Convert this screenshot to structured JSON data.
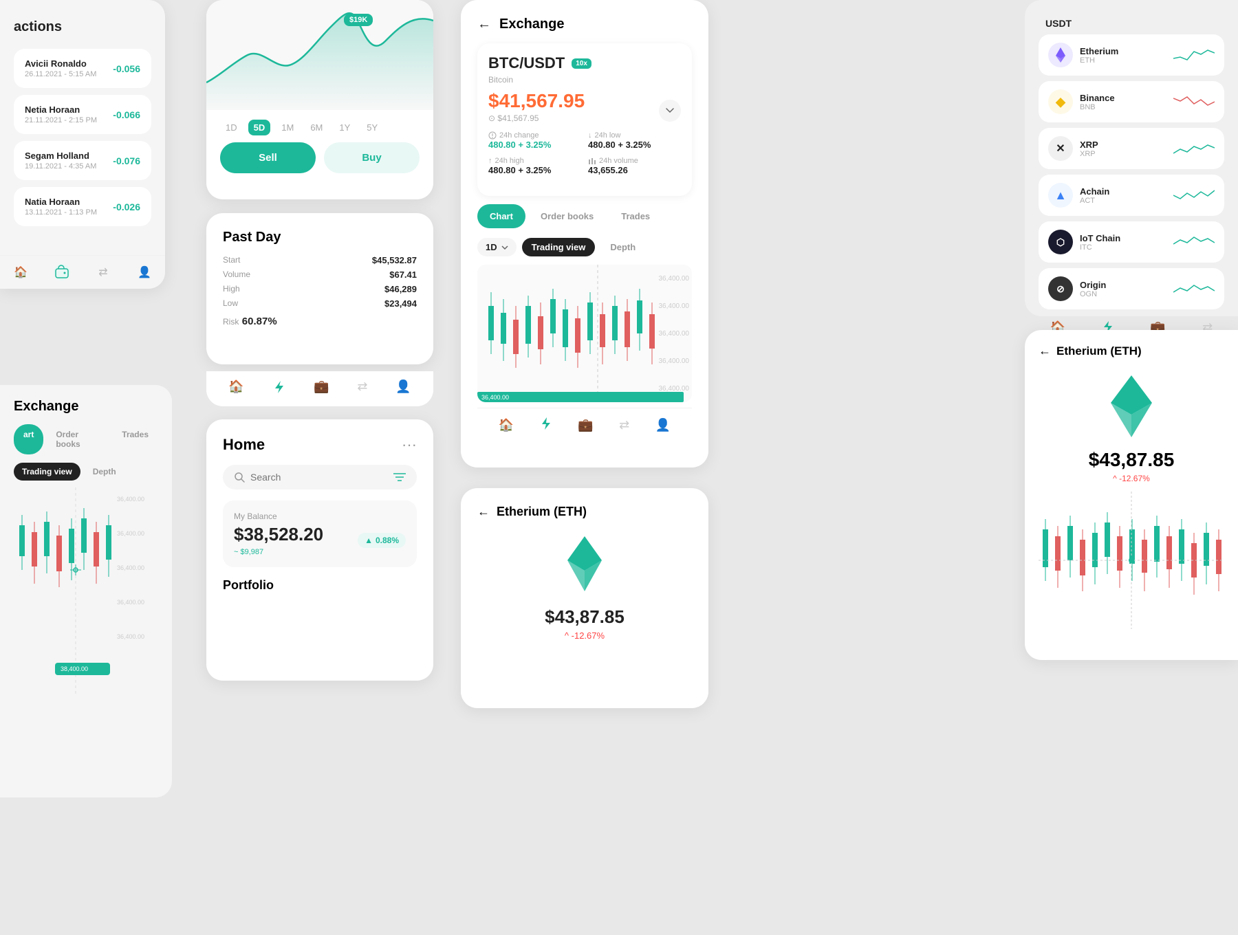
{
  "panels": {
    "transactions": {
      "title": "actions",
      "items": [
        {
          "name": "Avicii Ronaldo",
          "date": "26.11.2021 - 5:15 AM",
          "value": "-0.056"
        },
        {
          "name": "Netia Horaan",
          "date": "21.11.2021 - 2:15 PM",
          "value": "-0.066"
        },
        {
          "name": "Segam Holland",
          "date": "19.11.2021 - 4:35 AM",
          "value": "-0.076"
        },
        {
          "name": "Natia Horaan",
          "date": "13.11.2021 - 1:13 PM",
          "value": "-0.026"
        }
      ]
    },
    "chart": {
      "price_bubble": "$19K",
      "time_filters": [
        "1D",
        "5D",
        "1M",
        "6M",
        "1Y",
        "5Y"
      ],
      "active_filter": "5D",
      "sell_label": "Sell",
      "buy_label": "Buy"
    },
    "past_day": {
      "title": "Past Day",
      "start_label": "Start",
      "start_val": "$45,532.87",
      "volume_label": "Volume",
      "volume_val": "$67.41",
      "high_label": "High",
      "high_val": "$46,289",
      "low_label": "Low",
      "low_val": "$23,494",
      "risk_label": "Risk",
      "risk_val": "60.87%"
    },
    "home": {
      "title": "Home",
      "search_placeholder": "Search",
      "balance_label": "My Balance",
      "balance_amount": "$38,528.20",
      "balance_badge": "0.88%",
      "balance_sub": "~ $9,987",
      "portfolio_title": "Portfolio"
    },
    "exchange": {
      "title": "Exchange",
      "pair": "BTC/USDT",
      "pair_leverage": "10x",
      "pair_name": "Bitcoin",
      "price": "$41,567.95",
      "price_sub": "⊙ $41,567.95",
      "change_24h_label": "24h change",
      "change_24h_val": "480.80 + 3.25%",
      "low_24h_label": "24h low",
      "low_24h_val": "480.80 + 3.25%",
      "high_24h_label": "24h high",
      "high_24h_val": "480.80 + 3.25%",
      "volume_24h_label": "24h volume",
      "volume_24h_val": "43,655.26",
      "tab_chart": "Chart",
      "tab_orderbooks": "Order books",
      "tab_trades": "Trades",
      "period": "1D",
      "view_tradingview": "Trading view",
      "view_depth": "Depth",
      "price_levels": [
        "36,400.00",
        "36,400.00",
        "36,400.00",
        "36,400.00",
        "36,400.00"
      ]
    },
    "exchange_left": {
      "title": "Exchange",
      "tab_chart": "art",
      "tab_orderbooks": "Order books",
      "tab_trades": "Trades",
      "view_tradingview": "Trading view",
      "view_depth": "Depth"
    },
    "crypto_list": {
      "usdt_name": "USDT",
      "items": [
        {
          "name": "Etherium",
          "ticker": "ETH",
          "color": "#7c5cfc",
          "text": "E"
        },
        {
          "name": "Binance",
          "ticker": "BNB",
          "color": "#f0b90b",
          "text": "B"
        },
        {
          "name": "XRP",
          "ticker": "XRP",
          "color": "#222",
          "text": "✕"
        },
        {
          "name": "Achain",
          "ticker": "ACT",
          "color": "#3b82f6",
          "text": "▲"
        },
        {
          "name": "IoT Chain",
          "ticker": "ITC",
          "color": "#1a1a2e",
          "text": "⬡"
        },
        {
          "name": "Origin",
          "ticker": "OGN",
          "color": "#333",
          "text": "⊘"
        }
      ]
    },
    "eth_detail": {
      "title": "Etherium (ETH)",
      "price": "$43,87.85",
      "change": "^ -12.67%"
    },
    "eth_bottom": {
      "title": "Etherium (ETH)",
      "price": "$43,87.85",
      "change": "^ -12.67%"
    }
  },
  "colors": {
    "teal": "#1DB89A",
    "red": "#ff4444",
    "orange": "#ff6b35",
    "purple": "#7c5cfc",
    "gold": "#f0b90b"
  }
}
